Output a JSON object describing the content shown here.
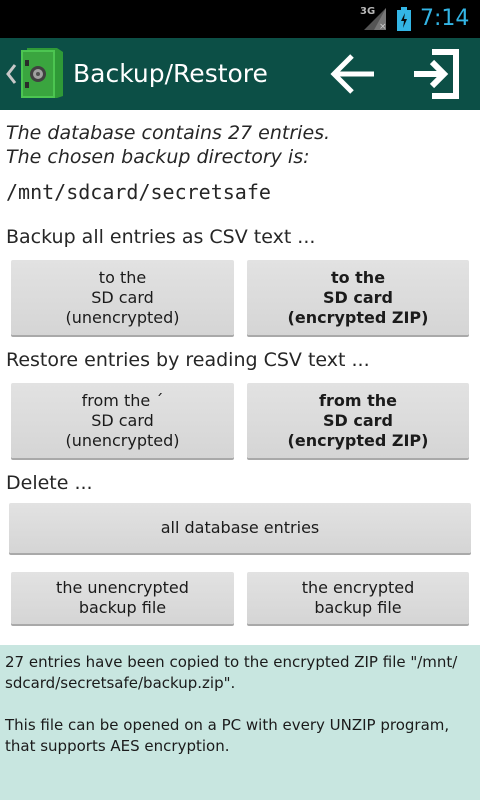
{
  "status_bar": {
    "network": "3G",
    "time": "7:14"
  },
  "action_bar": {
    "title": "Backup/Restore",
    "back_icon": "arrow-left-icon",
    "exit_icon": "exit-icon",
    "logo_icon": "safe-icon"
  },
  "info": {
    "line1": "The database contains 27 entries.",
    "line2": "The chosen backup directory is:",
    "path": "/mnt/sdcard/secretsafe"
  },
  "backup": {
    "label": "Backup all entries as CSV text ...",
    "unencrypted": "to the\nSD card\n(unencrypted)",
    "encrypted": "to the\nSD card\n(encrypted ZIP)"
  },
  "restore": {
    "label": "Restore entries by reading CSV text ...",
    "unencrypted": "from the ´\nSD card\n(unencrypted)",
    "encrypted": "from the\nSD card\n(encrypted ZIP)"
  },
  "delete": {
    "label": "Delete ...",
    "all_entries": "all database entries",
    "unencrypted_file": "the unencrypted\nbackup file",
    "encrypted_file": "the encrypted\nbackup file"
  },
  "message": {
    "text1": "27 entries have been copied to the encrypted ZIP file \"/mnt/\nsdcard/secretsafe/backup.zip\".",
    "text2": "This file can be opened on a PC with every UNZIP program,\nthat supports AES encryption."
  },
  "colors": {
    "action_bar": "#0c4f46",
    "status_time": "#33b5e5",
    "message_bg": "#c8e6e0",
    "button_bg": "#dcdcdc"
  }
}
